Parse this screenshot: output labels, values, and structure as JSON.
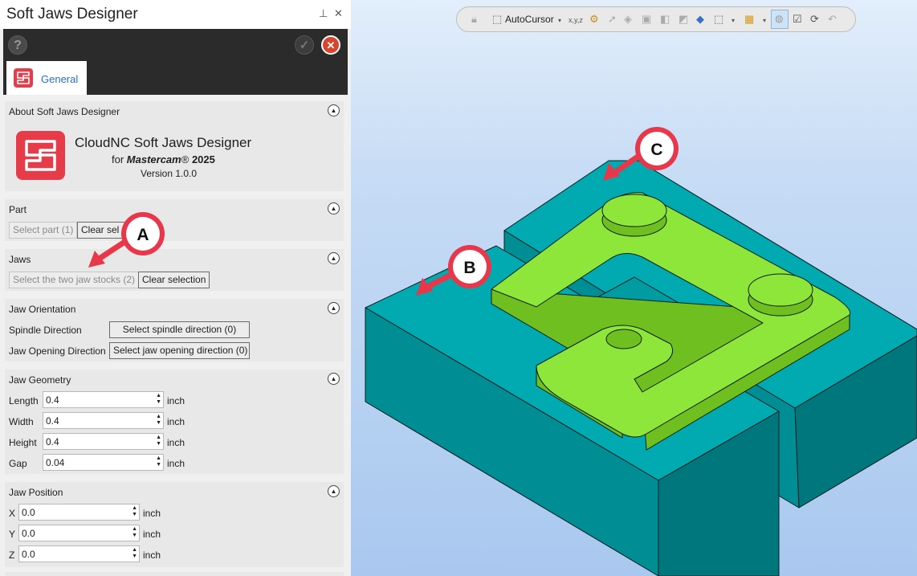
{
  "panel": {
    "title": "Soft Jaws Designer",
    "pin_glyph": "⊥",
    "close_glyph": "✕",
    "help_glyph": "?",
    "ok_glyph": "✓",
    "cancel_glyph": "✕",
    "tab_general": "General"
  },
  "about": {
    "header": "About Soft Jaws Designer",
    "product": "CloudNC Soft Jaws Designer",
    "for_prefix": "for",
    "for_brand": "Mastercam",
    "for_reg": "®",
    "for_year": "2025",
    "version": "Version 1.0.0"
  },
  "part": {
    "header": "Part",
    "select_button": "Select part (1)",
    "clear_button": "Clear sel"
  },
  "jaws": {
    "header": "Jaws",
    "select_button": "Select the two jaw stocks (2)",
    "clear_button": "Clear selection"
  },
  "orientation": {
    "header": "Jaw Orientation",
    "spindle_label": "Spindle Direction",
    "spindle_button": "Select spindle direction (0)",
    "opening_label": "Jaw Opening Direction",
    "opening_button": "Select jaw opening direction (0)"
  },
  "geometry": {
    "header": "Jaw Geometry",
    "fields": [
      {
        "label": "Length",
        "value": "0.4",
        "unit": "inch"
      },
      {
        "label": "Width",
        "value": "0.4",
        "unit": "inch"
      },
      {
        "label": "Height",
        "value": "0.4",
        "unit": "inch"
      },
      {
        "label": "Gap",
        "value": "0.04",
        "unit": "inch"
      }
    ]
  },
  "position": {
    "header": "Jaw Position",
    "fields": [
      {
        "label": "X",
        "value": "0.0",
        "unit": "inch"
      },
      {
        "label": "Y",
        "value": "0.0",
        "unit": "inch"
      },
      {
        "label": "Z",
        "value": "0.0",
        "unit": "inch"
      }
    ]
  },
  "toolbar": {
    "autocursor": "AutoCursor",
    "xyz": "x,y,z"
  },
  "callouts": {
    "a": "A",
    "b": "B",
    "c": "C"
  },
  "colors": {
    "stock_top": "#00aab0",
    "stock_front": "#008e94",
    "stock_side": "#00777c",
    "part_top": "#8fe63a",
    "part_side": "#6fbf21",
    "callout_red": "#e8374a",
    "logo_red": "#e63b49"
  }
}
